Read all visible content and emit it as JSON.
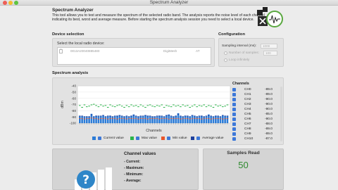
{
  "window": {
    "title": "Spectrum Analyzer"
  },
  "app": {
    "title": "Spectrum Analyzer",
    "intro": "This tool allows you to test and measure the spectrum of the selected radio band. The analysis reports the noise level of each channel indicating its best, worst and average measure. Before starting the spectrum analysis session you need to select a local device."
  },
  "device_selection": {
    "heading": "Device selection",
    "label": "Select the local radio device:",
    "devices": [
      {
        "address": "0013A20040885480",
        "name": "DigiMesh",
        "type": "AT"
      }
    ]
  },
  "configuration": {
    "heading": "Configuration",
    "interval_label": "Sampling interval (ms):",
    "interval_value": "1000",
    "samples_label": "Number of samples:",
    "samples_value": "100",
    "loop_label": "Loop infinitely"
  },
  "spectrum": {
    "heading": "Spectrum analysis",
    "legend": {
      "current": "Current value",
      "max": "Max value",
      "min": "Min value",
      "avg": "Average value"
    },
    "channels_heading": "Channels",
    "channels": [
      {
        "name": "CH0",
        "value": "-89.0"
      },
      {
        "name": "CH1",
        "value": "-89.0"
      },
      {
        "name": "CH2",
        "value": "-90.0"
      },
      {
        "name": "CH3",
        "value": "-90.0"
      },
      {
        "name": "CH4",
        "value": "-90.0"
      },
      {
        "name": "CH5",
        "value": "-85.0"
      },
      {
        "name": "CH6",
        "value": "-90.0"
      },
      {
        "name": "CH7",
        "value": "-88.0"
      },
      {
        "name": "CH8",
        "value": "-89.0"
      },
      {
        "name": "CH9",
        "value": "-89.0"
      },
      {
        "name": "CH10",
        "value": "-87.0"
      }
    ]
  },
  "channel_values": {
    "title": "Channel values",
    "current_label": "- Current:",
    "maximum_label": "- Maximum:",
    "minimum_label": "- Minimum:",
    "average_label": "- Average:"
  },
  "samples_read": {
    "title": "Samples Read",
    "value": "50"
  },
  "colors": {
    "current": "#2b7bd6",
    "max": "#2bb34a",
    "min": "#e8552a",
    "avg": "#1d3f9c",
    "samples_value": "#2f8a2f"
  },
  "chart_data": {
    "type": "bar",
    "ylabel": "dBm",
    "xlabel": "Channels",
    "ylim": [
      -100,
      -40
    ],
    "yticks": [
      -40,
      -50,
      -60,
      -70,
      -80,
      -90,
      -100
    ],
    "series": [
      {
        "name": "Current value",
        "values": [
          -89,
          -89,
          -90,
          -90,
          -90,
          -85,
          -90,
          -88,
          -89,
          -89,
          -87,
          -90,
          -89,
          -88,
          -90,
          -89,
          -88,
          -87,
          -89,
          -90,
          -89,
          -90,
          -88,
          -86,
          -89,
          -90,
          -89,
          -89,
          -87,
          -88,
          -89,
          -90,
          -90,
          -89,
          -88,
          -89,
          -90,
          -87,
          -86,
          -89,
          -90,
          -88,
          -84,
          -89,
          -90,
          -88,
          -89,
          -90,
          -87,
          -89,
          -90,
          -89,
          -88,
          -90,
          -89,
          -86,
          -89,
          -90,
          -88,
          -89,
          -90,
          -87,
          -89,
          -89
        ]
      },
      {
        "name": "Max value",
        "values": [
          -71,
          -74,
          -70,
          -73,
          -72,
          -70,
          -69,
          -71,
          -73,
          -70,
          -72,
          -71,
          -74,
          -70,
          -72,
          -73,
          -71,
          -70,
          -72,
          -74,
          -71,
          -73,
          -70,
          -72,
          -71,
          -73,
          -70,
          -72,
          -74,
          -71,
          -70,
          -72,
          -73,
          -71,
          -72,
          -70,
          -74,
          -71,
          -72,
          -73,
          -70,
          -72,
          -71,
          -73,
          -70,
          -72,
          -71,
          -74,
          -72,
          -70,
          -73,
          -71,
          -72,
          -70,
          -73,
          -71,
          -72,
          -74,
          -70,
          -72,
          -71,
          -73,
          -72,
          -70
        ]
      },
      {
        "name": "Min value",
        "values": [
          -92,
          -92,
          -93,
          -92,
          -92,
          -91,
          -92,
          -92,
          -93,
          -92,
          -92,
          -92,
          -93,
          -92,
          -92,
          -92,
          -93,
          -92,
          -92,
          -92,
          -93,
          -92,
          -92,
          -92,
          -92,
          -93,
          -92,
          -92,
          -92,
          -93,
          -92,
          -92,
          -92,
          -92,
          -93,
          -92,
          -92,
          -92,
          -93,
          -92,
          -92,
          -92,
          -92,
          -93,
          -92,
          -92,
          -92,
          -93,
          -92,
          -92,
          -92,
          -92,
          -93,
          -92,
          -92,
          -92,
          -93,
          -92,
          -92,
          -92,
          -92,
          -93,
          -92,
          -92
        ]
      },
      {
        "name": "Average value",
        "values": [
          -88,
          -88,
          -89,
          -89,
          -89,
          -86,
          -89,
          -88,
          -88,
          -88,
          -87,
          -89,
          -88,
          -88,
          -89,
          -88,
          -88,
          -87,
          -88,
          -89,
          -88,
          -89,
          -88,
          -87,
          -88,
          -89,
          -88,
          -88,
          -87,
          -88,
          -88,
          -89,
          -89,
          -88,
          -88,
          -88,
          -89,
          -87,
          -87,
          -88,
          -89,
          -88,
          -85,
          -88,
          -89,
          -88,
          -88,
          -89,
          -87,
          -88,
          -89,
          -88,
          -88,
          -89,
          -88,
          -87,
          -88,
          -89,
          -88,
          -88,
          -89,
          -87,
          -88,
          -88
        ]
      }
    ]
  }
}
